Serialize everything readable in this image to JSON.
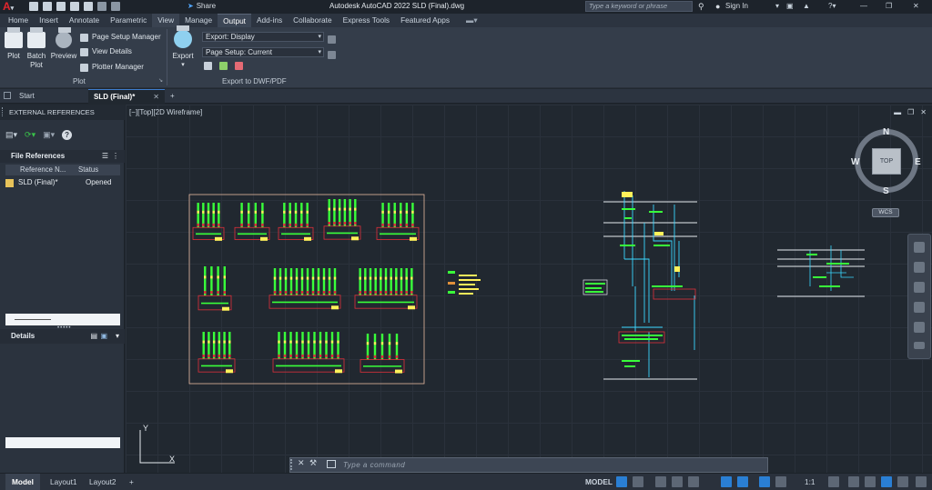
{
  "titlebar": {
    "share_label": "Share",
    "app_title": "Autodesk AutoCAD 2022   SLD (Final).dwg",
    "search_placeholder": "Type a keyword or phrase",
    "signin_label": "Sign In"
  },
  "ribbon_tabs": [
    "Home",
    "Insert",
    "Annotate",
    "Parametric",
    "View",
    "Manage",
    "Output",
    "Add-ins",
    "Collaborate",
    "Express Tools",
    "Featured Apps"
  ],
  "ribbon_active_tab": "Output",
  "ribbon": {
    "plot_label": "Plot",
    "batch_plot_label": "Batch\nPlot",
    "preview_label": "Preview",
    "page_setup_manager": "Page Setup Manager",
    "view_details": "View Details",
    "plotter_manager": "Plotter Manager",
    "plot_panel_label": "Plot",
    "export_label": "Export",
    "export_dropdown": "Export: Display",
    "page_setup_dropdown": "Page Setup: Current",
    "export_panel_label": "Export to DWF/PDF"
  },
  "doc_tabs": {
    "start": "Start",
    "active": "SLD (Final)*",
    "add": "+"
  },
  "palette": {
    "title": "EXTERNAL REFERENCES",
    "file_references": "File References",
    "columns": [
      "Reference N...",
      "Status"
    ],
    "rows": [
      {
        "name": "SLD (Final)*",
        "status": "Opened"
      }
    ],
    "details": "Details"
  },
  "viewport": {
    "label": "[−][Top][2D Wireframe]",
    "cube_top": "TOP",
    "north": "N",
    "south": "S",
    "east": "E",
    "west": "W",
    "wcs": "WCS"
  },
  "command": {
    "placeholder": "Type a command"
  },
  "status": {
    "tabs": [
      "Model",
      "Layout1",
      "Layout2"
    ],
    "add": "+",
    "model_label": "MODEL",
    "scale": "1:1"
  },
  "colors": {
    "accent": "#2a7fd4",
    "canvas_bg": "#212830",
    "drawing_green": "#39ff3a",
    "drawing_yellow": "#fff15a",
    "drawing_red": "#e0303a"
  }
}
